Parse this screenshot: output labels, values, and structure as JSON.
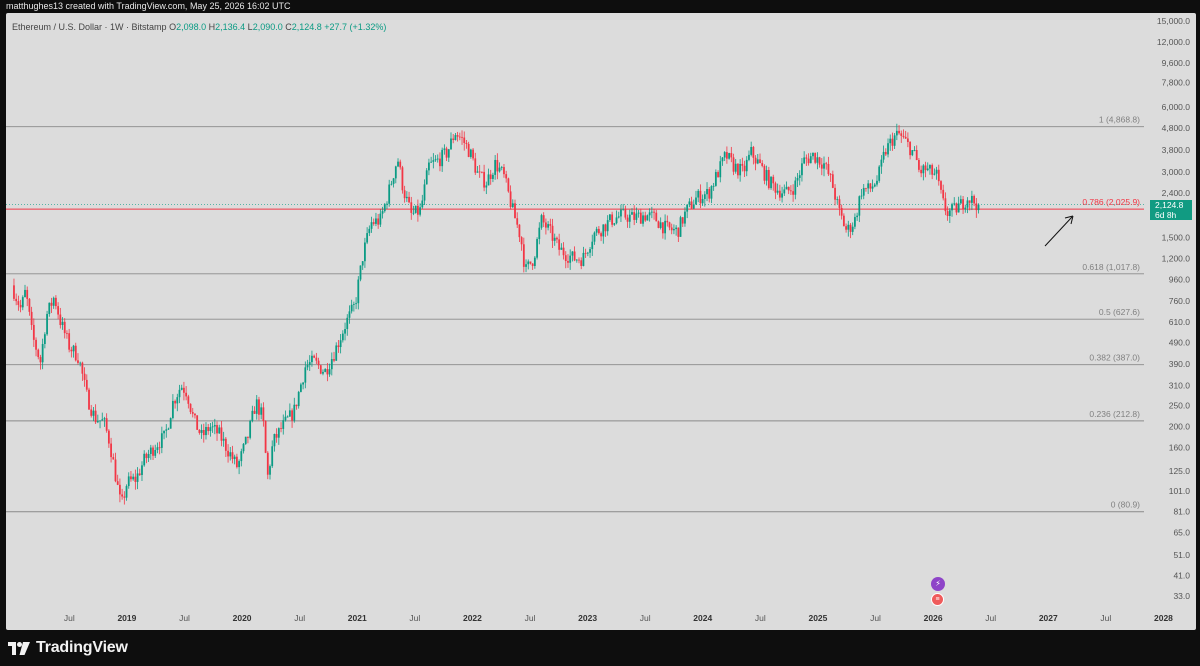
{
  "header": {
    "attribution": "matthughes13 created with TradingView.com, May 25, 2026 16:02 UTC"
  },
  "legend": {
    "symbol": "Ethereum / U.S. Dollar · 1W · Bitstamp",
    "o_label": "O",
    "o_value": "2,098.0",
    "h_label": "H",
    "h_value": "2,136.4",
    "l_label": "L",
    "l_value": "2,090.0",
    "c_label": "C",
    "c_value": "2,124.8",
    "change": "+27.7 (+1.32%)"
  },
  "price_tag": {
    "price": "2,124.8",
    "countdown": "6d 8h"
  },
  "footer": {
    "brand": "TradingView"
  },
  "colors": {
    "up": "#0a9b84",
    "down": "#f23645",
    "fib_line": "#7a7a7a",
    "fib_red": "#f23645",
    "panel_bg": "#dcdcdc",
    "frame_bg": "#0e0e0e"
  },
  "icons": [
    "tradingview-logo-icon",
    "earnings-event-icon",
    "us-flag-event-icon",
    "arrow-annotation-icon"
  ],
  "chart_data": {
    "type": "candlestick",
    "title": "Ethereum / U.S. Dollar · 1W · Bitstamp",
    "y_scale": "log",
    "ylim": [
      33,
      15000
    ],
    "y_ticks": [
      "15,000.0",
      "12,000.0",
      "9,600.0",
      "7,800.0",
      "6,000.0",
      "4,800.0",
      "3,800.0",
      "3,000.0",
      "2,400.0",
      "1,500.0",
      "1,200.0",
      "960.0",
      "760.0",
      "610.0",
      "490.0",
      "390.0",
      "310.0",
      "250.0",
      "200.0",
      "160.0",
      "125.0",
      "101.0",
      "81.0",
      "65.0",
      "51.0",
      "41.0",
      "33.0"
    ],
    "x_ticks": [
      {
        "label": "Jul",
        "date": "2018.5"
      },
      {
        "label": "2019",
        "date": "2019.0"
      },
      {
        "label": "Jul",
        "date": "2019.5"
      },
      {
        "label": "2020",
        "date": "2020.0"
      },
      {
        "label": "Jul",
        "date": "2020.5"
      },
      {
        "label": "2021",
        "date": "2021.0"
      },
      {
        "label": "Jul",
        "date": "2021.5"
      },
      {
        "label": "2022",
        "date": "2022.0"
      },
      {
        "label": "Jul",
        "date": "2022.5"
      },
      {
        "label": "2023",
        "date": "2023.0"
      },
      {
        "label": "Jul",
        "date": "2023.5"
      },
      {
        "label": "2024",
        "date": "2024.0"
      },
      {
        "label": "Jul",
        "date": "2024.5"
      },
      {
        "label": "2025",
        "date": "2025.0"
      },
      {
        "label": "Jul",
        "date": "2025.5"
      },
      {
        "label": "2026",
        "date": "2026.0"
      },
      {
        "label": "Jul",
        "date": "2026.5"
      },
      {
        "label": "2027",
        "date": "2027.0"
      },
      {
        "label": "Jul",
        "date": "2027.5"
      },
      {
        "label": "2028",
        "date": "2028.0"
      }
    ],
    "x_range": [
      2017.95,
      2028.3
    ],
    "fib_levels": [
      {
        "ratio": "1",
        "label": "1 (4,868.8)",
        "price": 4868.8,
        "highlight": false
      },
      {
        "ratio": "0.786",
        "label": "0.786 (2,025.9)",
        "price": 2025.9,
        "highlight": true
      },
      {
        "ratio": "0.618",
        "label": "0.618 (1,017.8)",
        "price": 1017.8,
        "highlight": false
      },
      {
        "ratio": "0.5",
        "label": "0.5 (627.6)",
        "price": 627.6,
        "highlight": false
      },
      {
        "ratio": "0.382",
        "label": "0.382 (387.0)",
        "price": 387.0,
        "highlight": false
      },
      {
        "ratio": "0.236",
        "label": "0.236 (212.8)",
        "price": 212.8,
        "highlight": false
      },
      {
        "ratio": "0",
        "label": "0 (80.9)",
        "price": 80.9,
        "highlight": false
      }
    ],
    "last_price": 2124.8,
    "price_path": [
      [
        2018.0,
        900
      ],
      [
        2018.08,
        700
      ],
      [
        2018.12,
        850
      ],
      [
        2018.18,
        520
      ],
      [
        2018.25,
        400
      ],
      [
        2018.3,
        650
      ],
      [
        2018.37,
        800
      ],
      [
        2018.42,
        620
      ],
      [
        2018.5,
        470
      ],
      [
        2018.58,
        420
      ],
      [
        2018.65,
        280
      ],
      [
        2018.72,
        220
      ],
      [
        2018.8,
        210
      ],
      [
        2018.85,
        170
      ],
      [
        2018.9,
        120
      ],
      [
        2018.95,
        85
      ],
      [
        2019.0,
        110
      ],
      [
        2019.08,
        115
      ],
      [
        2019.15,
        140
      ],
      [
        2019.25,
        165
      ],
      [
        2019.33,
        180
      ],
      [
        2019.4,
        260
      ],
      [
        2019.47,
        310
      ],
      [
        2019.52,
        290
      ],
      [
        2019.58,
        215
      ],
      [
        2019.65,
        180
      ],
      [
        2019.72,
        200
      ],
      [
        2019.8,
        185
      ],
      [
        2019.88,
        155
      ],
      [
        2019.96,
        130
      ],
      [
        2020.05,
        180
      ],
      [
        2020.12,
        260
      ],
      [
        2020.18,
        220
      ],
      [
        2020.22,
        115
      ],
      [
        2020.27,
        170
      ],
      [
        2020.35,
        200
      ],
      [
        2020.45,
        235
      ],
      [
        2020.55,
        380
      ],
      [
        2020.62,
        400
      ],
      [
        2020.72,
        360
      ],
      [
        2020.8,
        440
      ],
      [
        2020.9,
        600
      ],
      [
        2020.98,
        730
      ],
      [
        2021.05,
        1250
      ],
      [
        2021.12,
        1750
      ],
      [
        2021.2,
        1800
      ],
      [
        2021.27,
        2400
      ],
      [
        2021.35,
        3500
      ],
      [
        2021.4,
        2500
      ],
      [
        2021.47,
        1900
      ],
      [
        2021.55,
        2000
      ],
      [
        2021.62,
        3200
      ],
      [
        2021.7,
        3400
      ],
      [
        2021.78,
        3700
      ],
      [
        2021.85,
        4600
      ],
      [
        2021.92,
        4200
      ],
      [
        2021.98,
        3700
      ],
      [
        2022.05,
        2900
      ],
      [
        2022.12,
        2700
      ],
      [
        2022.2,
        3300
      ],
      [
        2022.27,
        2900
      ],
      [
        2022.35,
        2000
      ],
      [
        2022.42,
        1500
      ],
      [
        2022.46,
        1050
      ],
      [
        2022.53,
        1200
      ],
      [
        2022.6,
        1800
      ],
      [
        2022.67,
        1600
      ],
      [
        2022.75,
        1330
      ],
      [
        2022.82,
        1250
      ],
      [
        2022.88,
        1200
      ],
      [
        2022.96,
        1200
      ],
      [
        2023.05,
        1550
      ],
      [
        2023.12,
        1650
      ],
      [
        2023.2,
        1800
      ],
      [
        2023.3,
        1900
      ],
      [
        2023.4,
        1850
      ],
      [
        2023.5,
        1900
      ],
      [
        2023.58,
        1850
      ],
      [
        2023.68,
        1650
      ],
      [
        2023.78,
        1600
      ],
      [
        2023.86,
        2000
      ],
      [
        2023.95,
        2300
      ],
      [
        2024.05,
        2400
      ],
      [
        2024.12,
        2900
      ],
      [
        2024.2,
        3600
      ],
      [
        2024.27,
        3200
      ],
      [
        2024.35,
        3000
      ],
      [
        2024.42,
        3700
      ],
      [
        2024.5,
        3200
      ],
      [
        2024.58,
        2700
      ],
      [
        2024.65,
        2500
      ],
      [
        2024.72,
        2400
      ],
      [
        2024.8,
        2600
      ],
      [
        2024.88,
        3400
      ],
      [
        2024.96,
        3600
      ],
      [
        2025.05,
        3300
      ],
      [
        2025.12,
        2700
      ],
      [
        2025.18,
        2000
      ],
      [
        2025.25,
        1600
      ],
      [
        2025.32,
        1800
      ],
      [
        2025.38,
        2500
      ],
      [
        2025.45,
        2500
      ],
      [
        2025.52,
        2800
      ],
      [
        2025.58,
        3700
      ],
      [
        2025.65,
        4300
      ],
      [
        2025.7,
        4500
      ],
      [
        2025.75,
        4200
      ],
      [
        2025.8,
        3900
      ],
      [
        2025.85,
        3500
      ],
      [
        2025.88,
        3000
      ],
      [
        2025.93,
        3100
      ],
      [
        2025.98,
        3000
      ],
      [
        2026.03,
        2900
      ],
      [
        2026.08,
        2200
      ],
      [
        2026.12,
        1950
      ],
      [
        2026.18,
        2000
      ],
      [
        2026.25,
        2150
      ],
      [
        2026.3,
        2300
      ],
      [
        2026.35,
        2200
      ],
      [
        2026.4,
        2125
      ]
    ]
  }
}
